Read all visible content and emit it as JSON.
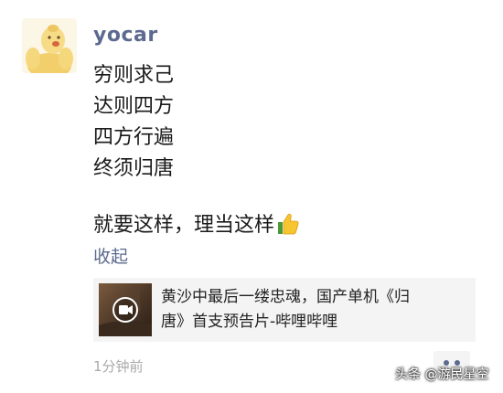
{
  "post": {
    "nickname": "yocar",
    "lines": [
      "穷则求己",
      "达则四方",
      "四方行遍",
      "终须归唐"
    ],
    "closing": "就要这样，理当这样",
    "closing_emoji": "thumbs-up-icon",
    "collapse_label": "收起"
  },
  "link_card": {
    "title_line1": "黄沙中最后一缕忠魂，国产单机《归",
    "title_line2": "唐》首支预告片-哔哩哔哩",
    "thumb_icon": "video-play-icon"
  },
  "footer": {
    "timestamp": "1分钟前",
    "more_icon": "more-dots-icon"
  },
  "watermark": {
    "text": "头条 @游民星空"
  },
  "colors": {
    "link": "#5c6a8f",
    "text": "#1a1a1a",
    "meta": "#a9a9a9",
    "card_bg": "#f4f4f4"
  }
}
